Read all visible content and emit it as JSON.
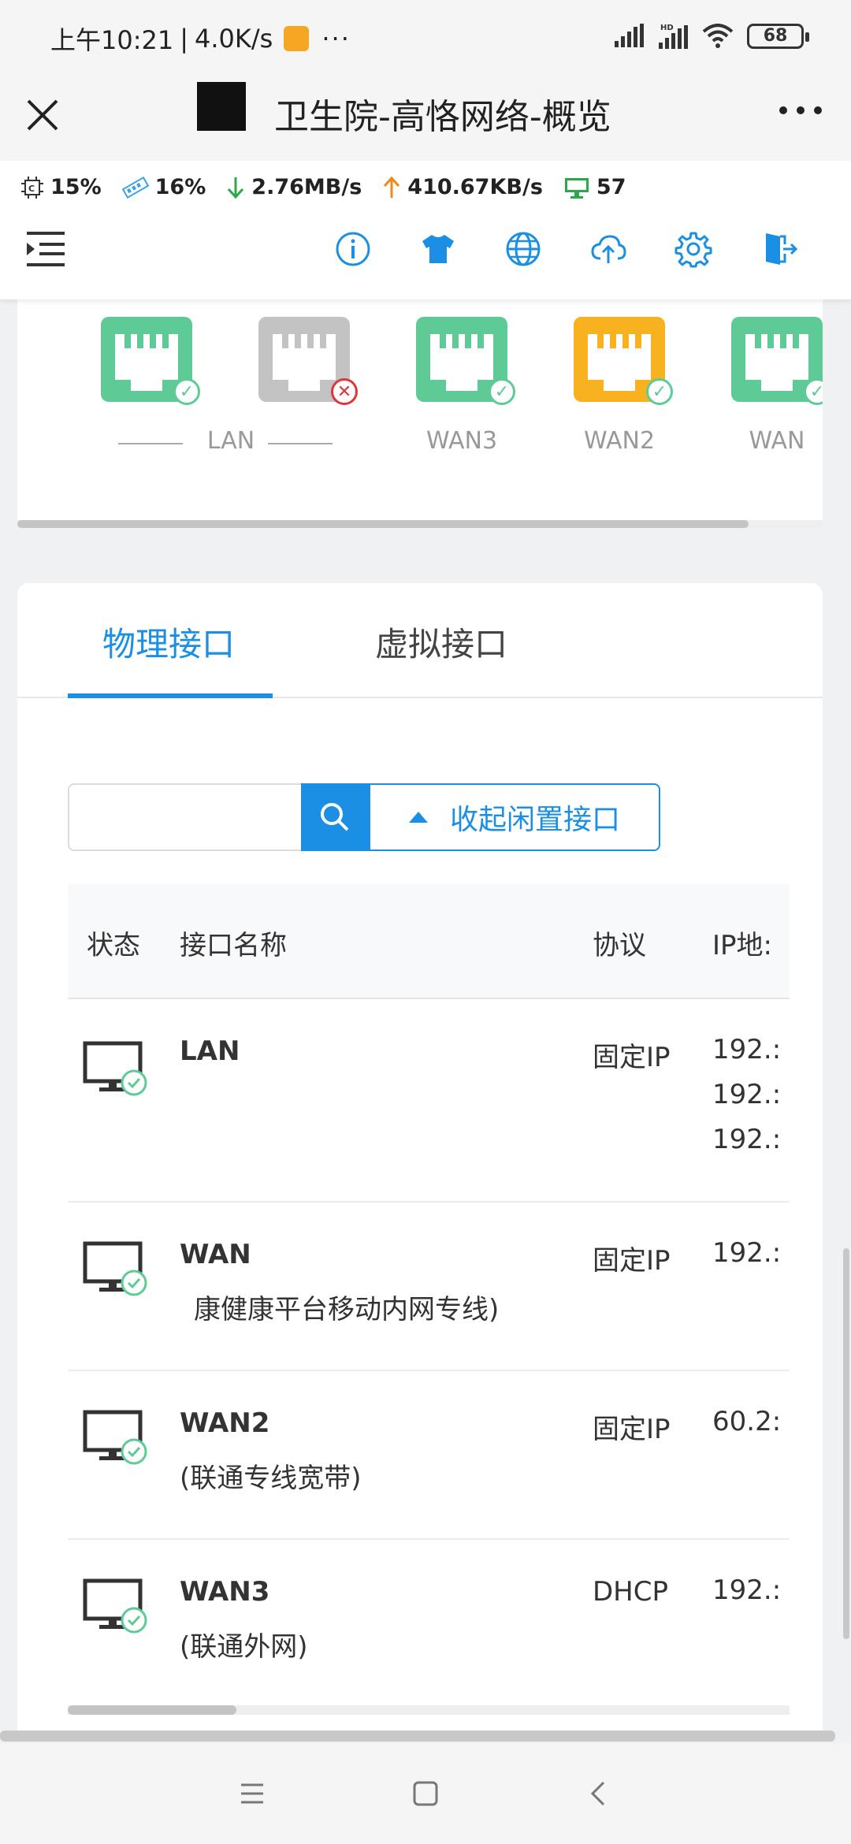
{
  "status_bar": {
    "time": "上午10:21",
    "separator": "|",
    "net_speed": "4.0K/s",
    "more": "···",
    "battery": "68"
  },
  "title_bar": {
    "title": "卫生院-高恪网络-概览"
  },
  "stats": {
    "cpu": "15%",
    "mem": "16%",
    "download": "2.76MB/s",
    "upload": "410.67KB/s",
    "clients": "57"
  },
  "ports": [
    {
      "label": "LAN",
      "status": "ok",
      "color": "#5ecb96"
    },
    {
      "label": "",
      "status": "down",
      "color": "#c3c3c3"
    },
    {
      "label": "WAN3",
      "status": "ok",
      "color": "#5ecb96"
    },
    {
      "label": "WAN2",
      "status": "ok",
      "color": "#f8b21f"
    },
    {
      "label": "WAN",
      "status": "ok",
      "color": "#5ecb96"
    }
  ],
  "tabs": {
    "physical": "物理接口",
    "virtual": "虚拟接口"
  },
  "search": {
    "placeholder": "",
    "collapse_label": "收起闲置接口"
  },
  "table": {
    "headers": {
      "status": "状态",
      "name": "接口名称",
      "protocol": "协议",
      "ip": "IP地:"
    },
    "rows": [
      {
        "name": "LAN",
        "sub": "",
        "protocol": "固定IP",
        "ip": [
          "192.:",
          "192.:",
          "192.:"
        ]
      },
      {
        "name": "WAN",
        "sub": "康健康平台移动内网专线)",
        "protocol": "固定IP",
        "ip": [
          "192.:"
        ]
      },
      {
        "name": "WAN2",
        "sub": "(联通专线宽带)",
        "protocol": "固定IP",
        "ip": [
          "60.2:"
        ]
      },
      {
        "name": "WAN3",
        "sub": "(联通外网)",
        "protocol": "DHCP",
        "ip": [
          "192.:"
        ]
      }
    ]
  },
  "colors": {
    "accent": "#1a8fe3",
    "ok": "#5ecb96",
    "down": "#e0353b",
    "warn": "#f8b21f"
  }
}
